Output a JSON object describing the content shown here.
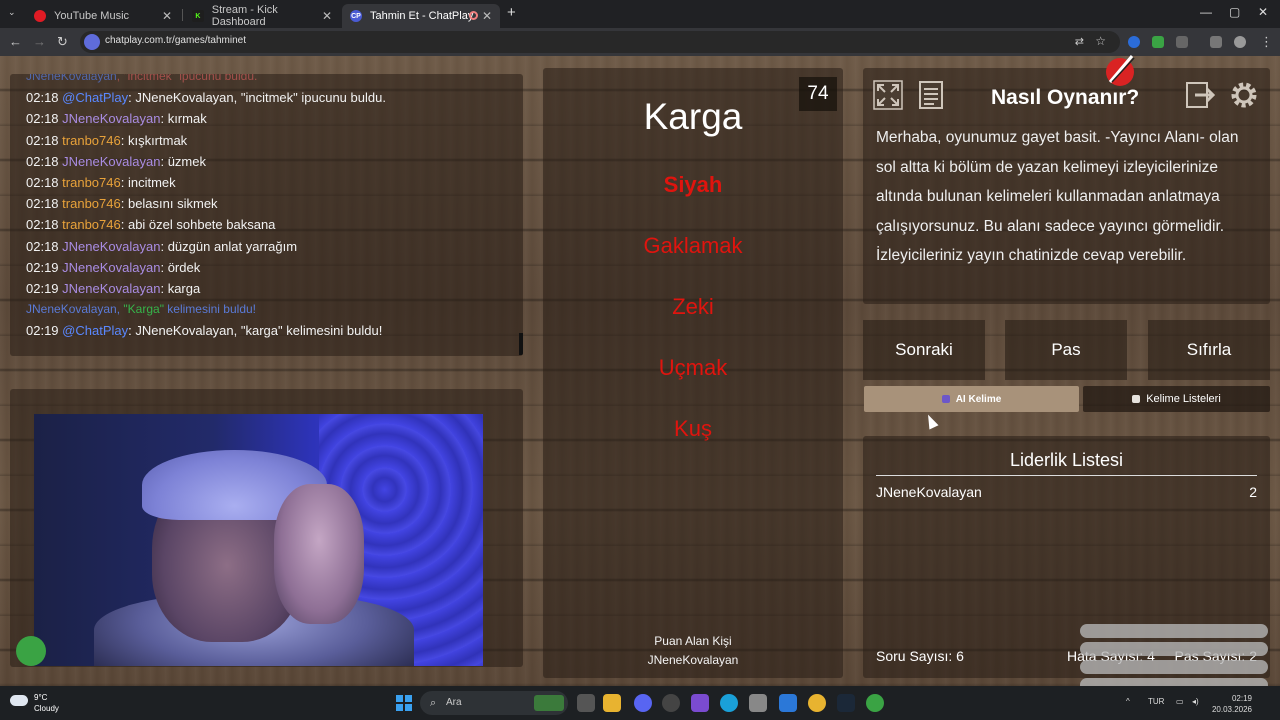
{
  "browser": {
    "tabs": [
      {
        "title": "YouTube Music",
        "active": false,
        "color": "#e01b24"
      },
      {
        "title": "Stream - Kick Dashboard",
        "active": false,
        "color": "#53fc18"
      },
      {
        "title": "Tahmin Et - ChatPlay",
        "active": true,
        "color": "#4a5bd4"
      }
    ],
    "favicon_text": {
      "chatplay": "CP",
      "kick": "K"
    },
    "new_tab": "+",
    "url": "chatplay.com.tr/games/tahminet"
  },
  "chat": {
    "partial_line": {
      "user": "JNeneKovalayan",
      "rest": ", \"incitmek\" ipucunu buldu."
    },
    "messages": [
      {
        "time": "02:18",
        "user": "@ChatPlay",
        "user_color": "blue",
        "text": ": JNeneKovalayan, \"incitmek\" ipucunu buldu."
      },
      {
        "time": "02:18",
        "user": "JNeneKovalayan",
        "user_color": "purple",
        "text": ": kırmak"
      },
      {
        "time": "02:18",
        "user": "tranbo746",
        "user_color": "orange",
        "text": ": kışkırtmak"
      },
      {
        "time": "02:18",
        "user": "JNeneKovalayan",
        "user_color": "purple",
        "text": ": üzmek"
      },
      {
        "time": "02:18",
        "user": "tranbo746",
        "user_color": "orange",
        "text": ": incitmek"
      },
      {
        "time": "02:18",
        "user": "tranbo746",
        "user_color": "orange",
        "text": ": belasını sikmek"
      },
      {
        "time": "02:18",
        "user": "tranbo746",
        "user_color": "orange",
        "text": ": abi özel sohbete baksana"
      },
      {
        "time": "02:18",
        "user": "JNeneKovalayan",
        "user_color": "purple",
        "text": ": düzgün anlat yarrağım"
      },
      {
        "time": "02:19",
        "user": "JNeneKovalayan",
        "user_color": "purple",
        "text": ": ördek"
      },
      {
        "time": "02:19",
        "user": "JNeneKovalayan",
        "user_color": "purple",
        "text": ": karga"
      }
    ],
    "system_line": {
      "user": "JNeneKovalayan, ",
      "word": "\"Karga\"",
      "rest": " kelimesini buldu!"
    },
    "final_message": {
      "time": "02:19",
      "user": "@ChatPlay",
      "text": ": JNeneKovalayan, \"karga\" kelimesini buldu!"
    }
  },
  "game": {
    "counter": "74",
    "main_word": "Karga",
    "forbidden_words": [
      "Siyah",
      "Gaklamak",
      "Zeki",
      "Uçmak",
      "Kuş"
    ],
    "scorer_label": "Puan Alan Kişi",
    "scorer_name": "JNeneKovalayan"
  },
  "howto": {
    "title": "Nasıl Oynanır?",
    "text": "Merhaba, oyunumuz gayet basit. -Yayıncı Alanı- olan sol altta ki bölüm de yazan kelimeyi izleyicilerinize altında bulunan kelimeleri kullanmadan anlatmaya çalışıyorsunuz. Bu alanı sadece yayıncı görmelidir. İzleyicileriniz yayın chatinizde cevap verebilir."
  },
  "controls": {
    "next": "Sonraki",
    "pass": "Pas",
    "reset": "Sıfırla",
    "ai_word": "AI Kelime",
    "word_lists": "Kelime Listeleri"
  },
  "leaderboard": {
    "title": "Liderlik Listesi",
    "rows": [
      {
        "name": "JNeneKovalayan",
        "score": "2"
      }
    ],
    "question_count": "Soru Sayısı: 6",
    "error_count": "Hata Sayısı: 4",
    "pass_count": "Pas Sayısı: 2"
  },
  "taskbar": {
    "temp": "9°C",
    "condition": "Cloudy",
    "search_placeholder": "Ara",
    "lang": "TUR",
    "time": "02:19",
    "date": "20.03.2026"
  },
  "colors": {
    "forbidden": "#e0140e",
    "user_purple": "#a98ce2",
    "user_orange": "#e8a23a",
    "user_blue": "#5a88ff"
  }
}
